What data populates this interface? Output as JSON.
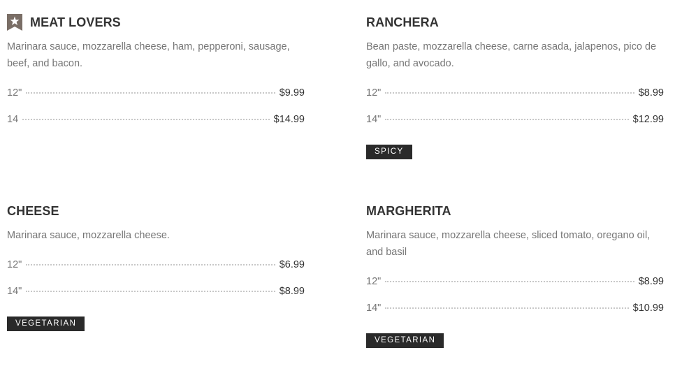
{
  "items": [
    {
      "name": "MEAT LOVERS",
      "featured": true,
      "description": "Marinara sauce, mozzarella cheese, ham, pepperoni, sausage, beef, and bacon.",
      "prices": [
        {
          "size": "12\"",
          "price": "$9.99"
        },
        {
          "size": "14",
          "price": "$14.99"
        }
      ],
      "tag": ""
    },
    {
      "name": "RANCHERA",
      "featured": false,
      "description": "Bean paste, mozzarella cheese, carne asada, jalapenos, pico de gallo, and avocado.",
      "prices": [
        {
          "size": "12\"",
          "price": "$8.99"
        },
        {
          "size": "14\"",
          "price": "$12.99"
        }
      ],
      "tag": "SPICY"
    },
    {
      "name": "CHEESE",
      "featured": false,
      "description": "Marinara sauce, mozzarella cheese.",
      "prices": [
        {
          "size": "12\"",
          "price": "$6.99"
        },
        {
          "size": "14\"",
          "price": "$8.99"
        }
      ],
      "tag": "VEGETARIAN"
    },
    {
      "name": "MARGHERITA",
      "featured": false,
      "description": "Marinara sauce, mozzarella cheese, sliced tomato, oregano oil, and basil",
      "prices": [
        {
          "size": "12\"",
          "price": "$8.99"
        },
        {
          "size": "14\"",
          "price": "$10.99"
        }
      ],
      "tag": "VEGETARIAN"
    }
  ],
  "colors": {
    "title": "#333333",
    "text": "#767676",
    "badge": "#7a6e66",
    "tag_bg": "#2a2a2a"
  },
  "icons": {
    "featured": "star-bookmark-icon"
  }
}
